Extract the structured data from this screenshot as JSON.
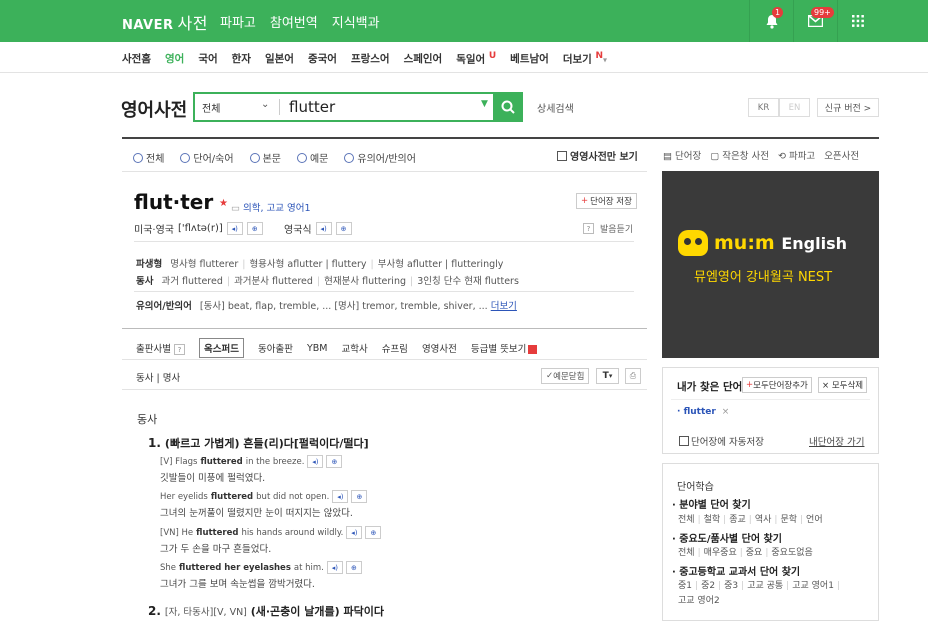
{
  "topbar": {
    "brand": "NAVER",
    "dict": "사전",
    "nav": [
      "파파고",
      "참여번역",
      "지식백과"
    ],
    "bell_badge": "1",
    "mail_badge": "99+",
    "icons": [
      "bell-icon",
      "mail-icon",
      "grid-icon"
    ]
  },
  "subnav": {
    "items": [
      {
        "label": "사전홈",
        "active": false
      },
      {
        "label": "영어",
        "active": true
      },
      {
        "label": "국어",
        "active": false
      },
      {
        "label": "한자",
        "active": false
      },
      {
        "label": "일본어",
        "active": false
      },
      {
        "label": "중국어",
        "active": false
      },
      {
        "label": "프랑스어",
        "active": false
      },
      {
        "label": "스페인어",
        "active": false
      },
      {
        "label": "독일어",
        "active": false,
        "mark": "U"
      },
      {
        "label": "베트남어",
        "active": false
      },
      {
        "label": "더보기",
        "active": false,
        "mark": "N"
      }
    ]
  },
  "search": {
    "title": "영어사전",
    "scope": "전체",
    "query": "flutter",
    "advanced": "상세검색",
    "lang_kr": "KR",
    "lang_en": "EN",
    "new_version": "신규 버전 >"
  },
  "filters": {
    "radios": [
      "전체",
      "단어/숙어",
      "본문",
      "예문",
      "유의어/반의어"
    ],
    "english_only": "영영사전만 보기",
    "tools": [
      "단어장",
      "작은창 사전",
      "파파고",
      "오픈사전"
    ]
  },
  "entry": {
    "headword": "flut·ter",
    "level": "의학, 고교 영어1",
    "save_word": "단어장 저장",
    "us_label": "미국·영국",
    "us_ipa": "['flʌtə(r)]",
    "uk_label": "영국식",
    "pron_help": "발음듣기",
    "derivations": {
      "label": "파생형",
      "items": [
        "명사형 flutterer",
        "형용사형 aflutter | fluttery",
        "부사형 aflutter | flutteringly"
      ]
    },
    "verb_forms": {
      "label": "동사",
      "items": [
        "과거 fluttered",
        "과거분사 fluttered",
        "현재분사 fluttering",
        "3인칭 단수 현재 flutters"
      ]
    },
    "synonyms": {
      "label": "유의어/반의어",
      "text": "[동사] beat, flap, tremble, ... [명사] tremor, tremble, shiver, ...",
      "more": "더보기"
    }
  },
  "publishers": {
    "label": "출판사별",
    "tabs": [
      "옥스퍼드",
      "동아출판",
      "YBM",
      "교학사",
      "슈프림",
      "영영사전",
      "등급별 뜻보기"
    ],
    "active": "옥스퍼드"
  },
  "pos_bar": {
    "pos": "동사 | 명사",
    "hide_examples": "예문닫힘",
    "font_btn": "T"
  },
  "definitions": {
    "pos_name": "동사",
    "senses": [
      {
        "num": "1.",
        "text": "(빠르고 가볍게) 흔들(리)다[펄럭이다/떨다]",
        "examples": [
          {
            "pre": "[V] Flags ",
            "bold": "fluttered",
            "post": " in the breeze.",
            "kr": "깃발들이 미풍에 펄럭였다."
          },
          {
            "pre": "Her eyelids ",
            "bold": "fluttered",
            "post": " but did not open.",
            "kr": "그녀의 눈꺼풀이 떨렸지만 눈이 떠지지는 않았다."
          },
          {
            "pre": "[VN] He ",
            "bold": "fluttered",
            "post": " his hands around wildly.",
            "kr": "그가 두 손을 마구 흔들었다."
          },
          {
            "pre": "She ",
            "bold": "fluttered her eyelashes",
            "post": " at him.",
            "kr": "그녀가 그를 보며 속눈썹을 깜박거렸다."
          }
        ]
      },
      {
        "num": "2.",
        "gram": "[자, 타동사][V, VN]",
        "text": "(새·곤충이 날개를) 파닥이다"
      }
    ]
  },
  "banner": {
    "brand": "mu:m",
    "brand2": "English",
    "sub": "뮤엠영어 강내월곡 NEST"
  },
  "my_find": {
    "title": "내가 찾은 단어",
    "add_all": "모두단어장추가",
    "delete_all": "× 모두삭제",
    "word": "flutter",
    "auto_save": "단어장에 자동저장",
    "go": "내단어장 가기"
  },
  "study": {
    "title": "단어학습",
    "groups": [
      {
        "cat": "분야별 단어 찾기",
        "subs": [
          "전체",
          "철학",
          "종교",
          "역사",
          "문학",
          "언어"
        ]
      },
      {
        "cat": "중요도/품사별 단어 찾기",
        "subs": [
          "전체",
          "매우중요",
          "중요",
          "중요도없음"
        ]
      },
      {
        "cat": "중고등학교 교과서 단어 찾기",
        "subs": [
          "중1",
          "중2",
          "중3",
          "고교 공통",
          "고교 영어1",
          "고교 영어2"
        ]
      }
    ]
  },
  "colors": {
    "brand_green": "#3cb15a",
    "link_blue": "#2c55b8",
    "red": "#e63c3c"
  }
}
